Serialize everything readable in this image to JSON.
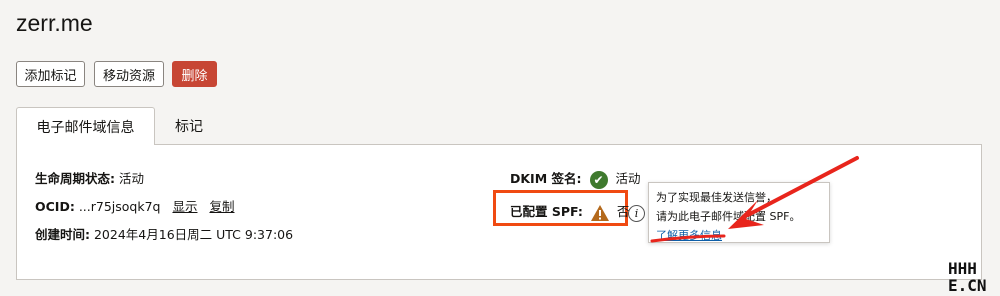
{
  "header": {
    "title": "zerr.me"
  },
  "toolbar": {
    "add_tag_label": "添加标记",
    "move_resource_label": "移动资源",
    "delete_label": "删除"
  },
  "tabs": [
    {
      "label": "电子邮件域信息",
      "active": true
    },
    {
      "label": "标记",
      "active": false
    }
  ],
  "details": {
    "lifecycle_label": "生命周期状态:",
    "lifecycle_value": "活动",
    "ocid_label": "OCID:",
    "ocid_value": "...r75jsoqk7q",
    "ocid_show": "显示",
    "ocid_copy": "复制",
    "created_label": "创建时间:",
    "created_value": "2024年4月16日周二 UTC 9:37:06",
    "dkim_label": "DKIM 签名:",
    "dkim_value": "活动",
    "spf_label": "已配置 SPF:",
    "spf_value": "否"
  },
  "popup": {
    "line1": "为了实现最佳发送信誉，",
    "line2": "请为此电子邮件域配置 SPF。",
    "link": "了解更多信息"
  },
  "watermark": {
    "line1": "HHH",
    "line2": "E.CN"
  },
  "colors": {
    "danger": "#c74634",
    "success": "#3f7a2e",
    "warning": "#b4691c",
    "highlight": "#f04a12",
    "annotation_arrow": "#e8251c"
  },
  "icons": [
    "check-circle-icon",
    "warning-triangle-icon",
    "info-icon",
    "annotation-arrow"
  ]
}
